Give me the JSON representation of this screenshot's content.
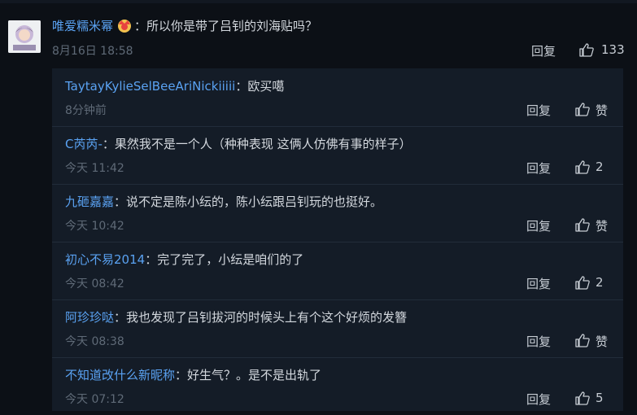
{
  "main_comment": {
    "user": "唯爱糯米幂",
    "separator": "：",
    "text": "所以你是带了吕钊的刘海贴吗？",
    "time": "8月16日 18:58",
    "reply_label": "回复",
    "likes": "133"
  },
  "replies": [
    {
      "user": "TaytayKylieSelBeeAriNickiiiii",
      "sep": "：",
      "text": "欧买噶",
      "time": "8分钟前",
      "reply_label": "回复",
      "likes": "赞"
    },
    {
      "user": "C芮芮-",
      "sep": "：",
      "text": "果然我不是一个人（种种表现 这俩人仿佛有事的样子）",
      "time": "今天 11:42",
      "reply_label": "回复",
      "likes": "2"
    },
    {
      "user": "九砸嘉嘉",
      "sep": "：",
      "text": "说不定是陈小纭的，陈小纭跟吕钊玩的也挺好。",
      "time": "今天 10:42",
      "reply_label": "回复",
      "likes": "赞"
    },
    {
      "user": "初心不易2014",
      "sep": "：",
      "text": "完了完了，小纭是咱们的了",
      "time": "今天 08:42",
      "reply_label": "回复",
      "likes": "2"
    },
    {
      "user": "阿珍珍哒",
      "sep": "：",
      "text": "我也发现了吕钊拔河的时候头上有个这个好烦的发簪",
      "time": "今天 08:38",
      "reply_label": "回复",
      "likes": "赞"
    },
    {
      "user": "不知道改什么新昵称",
      "sep": "：",
      "text": "好生气？。是不是出轨了",
      "time": "今天 07:12",
      "reply_label": "回复",
      "likes": "5"
    }
  ],
  "colors": {
    "username": "#5aa2f2",
    "text": "#d3d8de",
    "muted": "#5f6a77",
    "panel": "#141c27",
    "bg": "#0c1016"
  }
}
